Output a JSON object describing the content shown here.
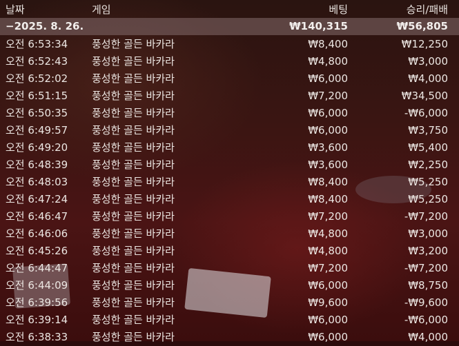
{
  "columns": {
    "date": "날짜",
    "game": "게임",
    "bet": "베팅",
    "winloss": "승리/패배"
  },
  "summary": {
    "date": "−2025. 8. 26.",
    "bet": "₩140,315",
    "winloss": "₩56,805"
  },
  "rows": [
    {
      "time": "오전 6:53:34",
      "game": "풍성한 골든 바카라",
      "bet": "₩8,400",
      "winloss": "₩12,250"
    },
    {
      "time": "오전 6:52:43",
      "game": "풍성한 골든 바카라",
      "bet": "₩4,800",
      "winloss": "₩3,000"
    },
    {
      "time": "오전 6:52:02",
      "game": "풍성한 골든 바카라",
      "bet": "₩6,000",
      "winloss": "₩4,000"
    },
    {
      "time": "오전 6:51:15",
      "game": "풍성한 골든 바카라",
      "bet": "₩7,200",
      "winloss": "₩34,500"
    },
    {
      "time": "오전 6:50:35",
      "game": "풍성한 골든 바카라",
      "bet": "₩6,000",
      "winloss": "-₩6,000"
    },
    {
      "time": "오전 6:49:57",
      "game": "풍성한 골든 바카라",
      "bet": "₩6,000",
      "winloss": "₩3,750"
    },
    {
      "time": "오전 6:49:20",
      "game": "풍성한 골든 바카라",
      "bet": "₩3,600",
      "winloss": "₩5,400"
    },
    {
      "time": "오전 6:48:39",
      "game": "풍성한 골든 바카라",
      "bet": "₩3,600",
      "winloss": "₩2,250"
    },
    {
      "time": "오전 6:48:03",
      "game": "풍성한 골든 바카라",
      "bet": "₩8,400",
      "winloss": "₩5,250"
    },
    {
      "time": "오전 6:47:24",
      "game": "풍성한 골든 바카라",
      "bet": "₩8,400",
      "winloss": "₩5,250"
    },
    {
      "time": "오전 6:46:47",
      "game": "풍성한 골든 바카라",
      "bet": "₩7,200",
      "winloss": "-₩7,200"
    },
    {
      "time": "오전 6:46:06",
      "game": "풍성한 골든 바카라",
      "bet": "₩4,800",
      "winloss": "₩3,000"
    },
    {
      "time": "오전 6:45:26",
      "game": "풍성한 골든 바카라",
      "bet": "₩4,800",
      "winloss": "₩3,200"
    },
    {
      "time": "오전 6:44:47",
      "game": "풍성한 골든 바카라",
      "bet": "₩7,200",
      "winloss": "-₩7,200"
    },
    {
      "time": "오전 6:44:09",
      "game": "풍성한 골든 바카라",
      "bet": "₩6,000",
      "winloss": "₩8,750"
    },
    {
      "time": "오전 6:39:56",
      "game": "풍성한 골든 바카라",
      "bet": "₩9,600",
      "winloss": "-₩9,600"
    },
    {
      "time": "오전 6:39:14",
      "game": "풍성한 골든 바카라",
      "bet": "₩6,000",
      "winloss": "-₩6,000"
    },
    {
      "time": "오전 6:38:33",
      "game": "풍성한 골든 바카라",
      "bet": "₩6,000",
      "winloss": "₩4,000"
    }
  ]
}
